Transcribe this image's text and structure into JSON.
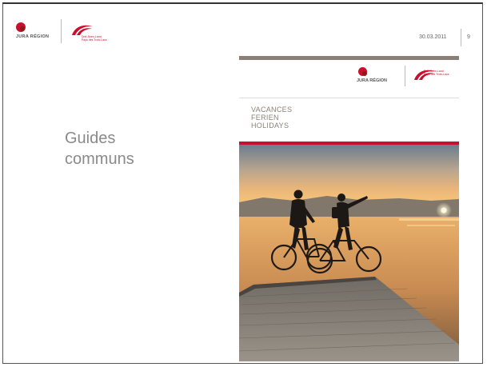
{
  "header": {
    "logo_text": "JURA RÉGION",
    "partner_text": "Drei-Seen-Land\nPays des Trois-Lacs",
    "date": "30.03.2011",
    "page_number": "9"
  },
  "slide": {
    "title_line1": "Guides",
    "title_line2": "communs"
  },
  "cover": {
    "logo_text": "JURA RÉGION",
    "partner_text": "Drei-Seen-Land\nPays des Trois-Lacs",
    "line1": "VACANCES",
    "line2": "FERIEN",
    "line3": "HOLIDAYS",
    "photo_icon": "sunset-cyclists-on-pier-image"
  },
  "colors": {
    "brand_red": "#c8102e",
    "title_grey": "#8a8a8a",
    "cover_taupe": "#8a8077"
  }
}
